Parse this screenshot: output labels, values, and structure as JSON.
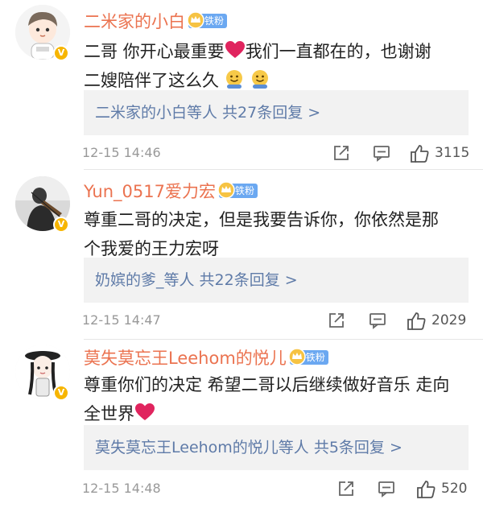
{
  "comments": [
    {
      "username": "二米家的小白",
      "badge": "铁粉",
      "text_line1": "二哥 你开心最重要",
      "text_line1b": "我们一直都在的，也谢谢",
      "text_line2": "二嫂陪伴了这么久",
      "reply_summary": "二米家的小白等人 共27条回复 >",
      "time": "12-15 14:46",
      "likes": "3115"
    },
    {
      "username": "Yun_0517爱力宏",
      "badge": "铁粉",
      "text_line1": "尊重二哥的决定，但是我要告诉你，你依然是那",
      "text_line2": "个我爱的王力宏呀",
      "reply_summary": "奶嫔的爹_等人 共22条回复 >",
      "time": "12-15 14:47",
      "likes": "2029"
    },
    {
      "username": "莫失莫忘王Leehom的悦儿",
      "badge": "铁粉",
      "text_line1": "尊重你们的决定 希望二哥以后继续做好音乐 走向",
      "text_line2": "全世界",
      "reply_summary": "莫失莫忘王Leehom的悦儿等人 共5条回复 >",
      "time": "12-15 14:48",
      "likes": "520"
    }
  ],
  "icons": {
    "verified": "verified-v-icon",
    "fan_crown": "crown-icon",
    "share": "share-icon",
    "comment": "comment-icon",
    "like": "thumbs-up-icon",
    "heart": "red-heart-emoji",
    "face": "smiley-emoji"
  },
  "colors": {
    "username": "#eb7350",
    "reply_link": "#5f7ba8",
    "fan_badge": "#6ba8f1",
    "verified": "#f7b500",
    "heart": "#e0245e"
  }
}
